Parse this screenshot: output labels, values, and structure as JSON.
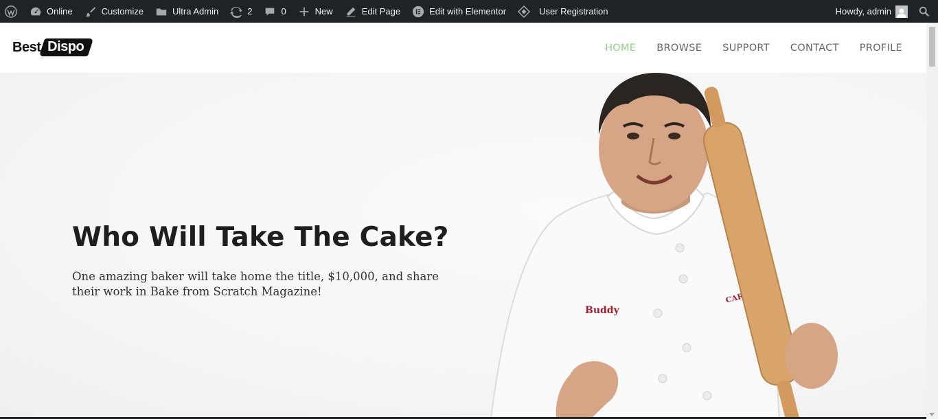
{
  "adminbar": {
    "wp_logo_icon": "wordpress-icon",
    "items": [
      {
        "icon": "dashboard-icon",
        "label": "Online"
      },
      {
        "icon": "brush-icon",
        "label": "Customize"
      },
      {
        "icon": "folder-icon",
        "label": "Ultra Admin"
      },
      {
        "icon": "updates-icon",
        "label": "2"
      },
      {
        "icon": "comment-icon",
        "label": "0"
      },
      {
        "icon": "plus-icon",
        "label": "New"
      },
      {
        "icon": "pencil-icon",
        "label": "Edit Page"
      },
      {
        "icon": "elementor-icon",
        "label": "Edit with Elementor"
      },
      {
        "icon": "diamond-icon",
        "label": "User Registration"
      }
    ],
    "howdy": "Howdy, admin",
    "search_icon": "search-icon"
  },
  "logo": {
    "part1": "Best",
    "part2": "Dispo"
  },
  "nav": {
    "items": [
      "HOME",
      "BROWSE",
      "SUPPORT",
      "CONTACT",
      "PROFILE"
    ],
    "active": "HOME",
    "active_color": "#8fd08a"
  },
  "hero": {
    "title": "Who Will Take The Cake?",
    "text": "One amazing baker will take home the title, $10,000, and share their work in Bake from Scratch Magazine!",
    "image": {
      "embroidered_name": "Buddy",
      "embroidered_logo": "CARLO'S"
    }
  },
  "colors": {
    "adminbar_bg": "#1d2327",
    "accent": "#8fd08a"
  }
}
